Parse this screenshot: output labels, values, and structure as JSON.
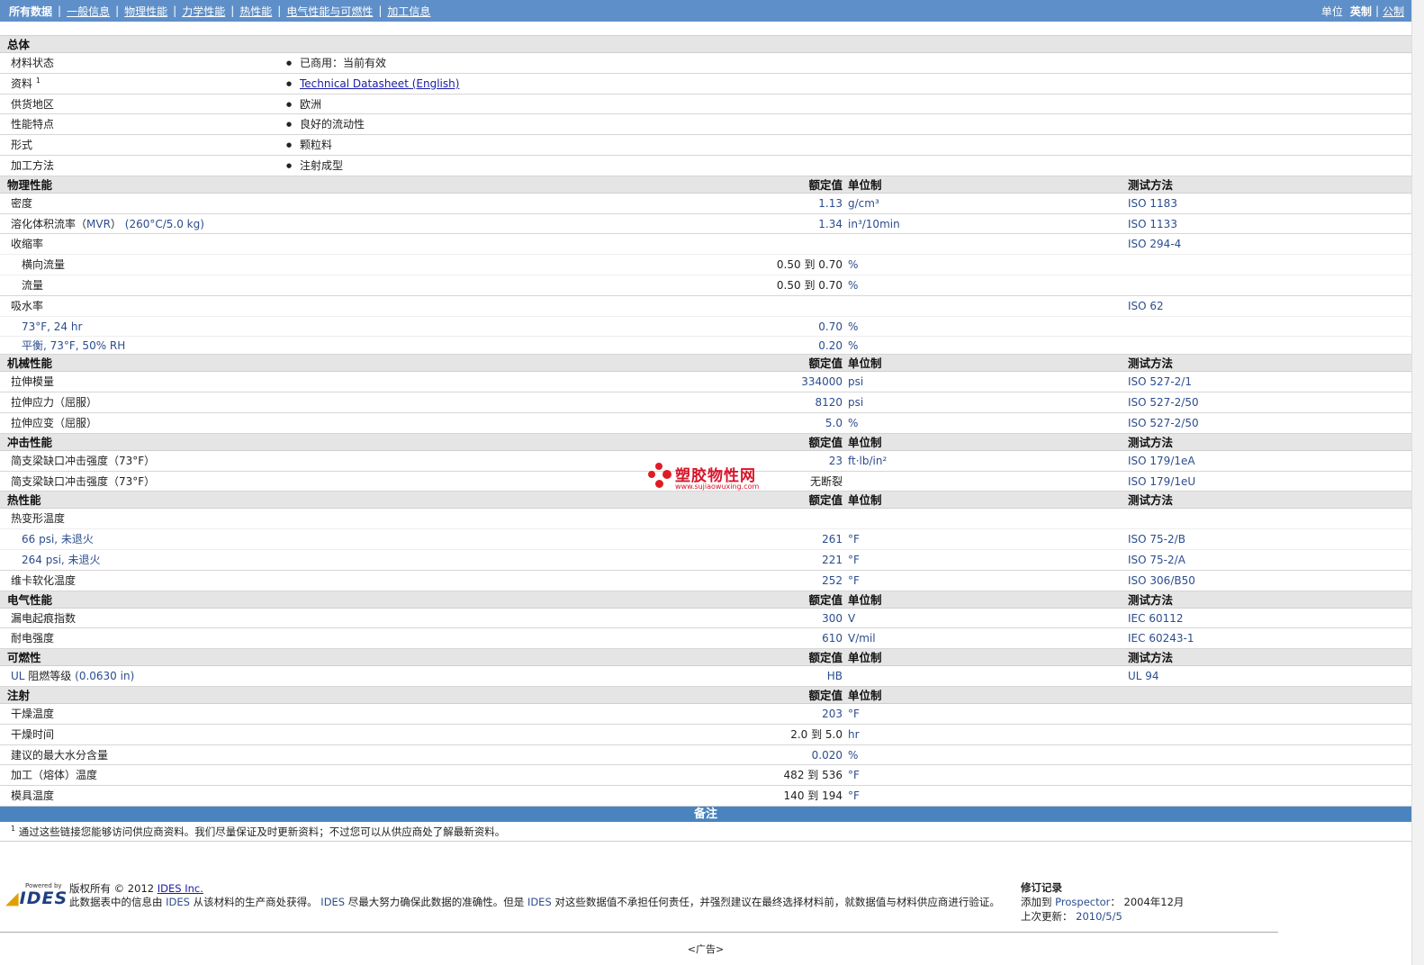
{
  "nav": {
    "items": [
      "所有数据",
      "一般信息",
      "物理性能",
      "力学性能",
      "热性能",
      "电气性能与可燃性",
      "加工信息"
    ],
    "units_label": "单位",
    "unit_english": "英制",
    "unit_metric": "公制"
  },
  "general": {
    "title": "总体",
    "rows": [
      {
        "label": "材料状态",
        "value": "已商用：当前有效"
      },
      {
        "label": "资料",
        "sup": "1",
        "value": "Technical Datasheet (English)"
      },
      {
        "label": "供货地区",
        "value": "欧洲"
      },
      {
        "label": "性能特点",
        "value": "良好的流动性"
      },
      {
        "label": "形式",
        "value": "颗粒料"
      },
      {
        "label": "加工方法",
        "value": "注射成型"
      }
    ]
  },
  "headers": {
    "nominal": "额定值",
    "unit": "单位制",
    "test": "测试方法"
  },
  "physical": {
    "title": "物理性能",
    "density": {
      "label": "密度",
      "value": "1.13",
      "unit": "g/cm³",
      "test": "ISO 1183"
    },
    "mvr": {
      "label_a": "溶化体积流率（",
      "label_b": "MVR",
      "label_c": "）",
      "label_d": "(260°C/5.0 kg)",
      "value": "1.34",
      "unit": "in³/10min",
      "test": "ISO 1133"
    },
    "shrink": {
      "label": "收缩率",
      "test": "ISO 294-4"
    },
    "shrink_cross": {
      "label": "横向流量",
      "value": "0.50 到  0.70",
      "unit": "%"
    },
    "shrink_flow": {
      "label": "流量",
      "value": "0.50 到  0.70",
      "unit": "%"
    },
    "water": {
      "label": "吸水率",
      "test": "ISO 62"
    },
    "water_24": {
      "label": "73°F, 24 hr",
      "value": "0.70",
      "unit": "%"
    },
    "water_eq": {
      "label": "平衡, 73°F, 50% RH",
      "value": "0.20",
      "unit": "%"
    }
  },
  "mechanical": {
    "title": "机械性能",
    "rows": [
      {
        "label": "拉伸模量",
        "value": "334000",
        "unit": "psi",
        "test": "ISO 527-2/1"
      },
      {
        "label": "拉伸应力（屈服）",
        "value": "8120",
        "unit": "psi",
        "test": "ISO 527-2/50"
      },
      {
        "label": "拉伸应变（屈服）",
        "value": "5.0",
        "unit": "%",
        "test": "ISO 527-2/50"
      }
    ]
  },
  "impact": {
    "title": "冲击性能",
    "rows": [
      {
        "label": "简支梁缺口冲击强度（73°F）",
        "value": "23",
        "unit": "ft·lb/in²",
        "test": "ISO 179/1eA"
      },
      {
        "label": "简支梁缺口冲击强度（73°F）",
        "value": "无断裂",
        "unit": "",
        "test": "ISO 179/1eU"
      }
    ]
  },
  "thermal": {
    "title": "热性能",
    "hdt": {
      "label": "热变形温度"
    },
    "hdt66": {
      "label": "66 psi, 未退火",
      "value": "261",
      "unit": "°F",
      "test": "ISO 75-2/B"
    },
    "hdt264": {
      "label": "264 psi, 未退火",
      "value": "221",
      "unit": "°F",
      "test": "ISO 75-2/A"
    },
    "vicat": {
      "label": "维卡软化温度",
      "value": "252",
      "unit": "°F",
      "test": "ISO 306/B50"
    }
  },
  "electrical": {
    "title": "电气性能",
    "rows": [
      {
        "label": "漏电起痕指数",
        "value": "300",
        "unit": "V",
        "test": "IEC 60112"
      },
      {
        "label": "耐电强度",
        "value": "610",
        "unit": "V/mil",
        "test": "IEC 60243-1"
      }
    ]
  },
  "flammability": {
    "title": "可燃性",
    "ul_a": "UL",
    "ul_b": "阻燃等级",
    "ul_c": "(0.0630 in)",
    "value": "HB",
    "test": "UL 94"
  },
  "injection": {
    "title": "注射",
    "rows": [
      {
        "label": "干燥温度",
        "value": "203",
        "unit": "°F"
      },
      {
        "label": "干燥时间",
        "value": "2.0 到  5.0",
        "unit": "hr"
      },
      {
        "label": "建议的最大水分含量",
        "value": "0.020",
        "unit": "%"
      },
      {
        "label": "加工（熔体）温度",
        "value": "482 到  536",
        "unit": "°F"
      },
      {
        "label": "模具温度",
        "value": "140 到  194",
        "unit": "°F"
      }
    ]
  },
  "notes": {
    "title": "备注",
    "sup": "1",
    "text": "通过这些链接您能够访问供应商资料。我们尽量保证及时更新资料；不过您可以从供应商处了解最新资料。"
  },
  "footer": {
    "logo_powered": "Powered by",
    "logo_text": "IDES",
    "copyright": "版权所有  © 2012",
    "copyright_link": "IDES Inc.",
    "disclaimer_a": "此数据表中的信息由",
    "disclaimer_ides1": "IDES",
    "disclaimer_b": "从该材料的生产商处获得。",
    "disclaimer_ides2": "IDES",
    "disclaimer_c": "尽最大努力确保此数据的准确性。但是",
    "disclaimer_ides3": "IDES",
    "disclaimer_d": "对这些数据值不承担任何责任，并强烈建议在最终选择材料前，就数据值与材料供应商进行验证。",
    "rev_title": "修订记录",
    "rev_added_label": "添加到",
    "rev_added_link": "Prospector",
    "rev_added_value": "2004年12月",
    "rev_updated_label": "上次更新：",
    "rev_updated_value": "2010/5/5"
  },
  "watermark": {
    "text": "塑胶物性网",
    "url": "www.sujiaowuxing.com"
  },
  "ad": "<广告>"
}
